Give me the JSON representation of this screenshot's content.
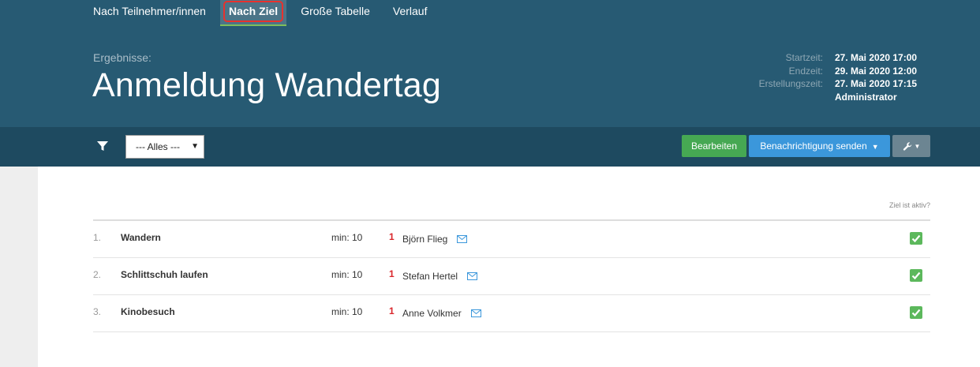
{
  "tabs": [
    {
      "label": "Nach Teilnehmer/innen",
      "active": false
    },
    {
      "label": "Nach Ziel",
      "active": true
    },
    {
      "label": "Große Tabelle",
      "active": false
    },
    {
      "label": "Verlauf",
      "active": false
    }
  ],
  "header": {
    "subtitle": "Ergebnisse:",
    "title": "Anmeldung Wandertag",
    "meta": [
      {
        "label": "Startzeit:",
        "value": "27. Mai 2020 17:00"
      },
      {
        "label": "Endzeit:",
        "value": "29. Mai 2020 12:00"
      },
      {
        "label": "Erstellungszeit:",
        "value": "27. Mai 2020 17:15",
        "value2": "Administrator"
      }
    ]
  },
  "toolbar": {
    "filter_icon": "filter-icon",
    "select_value": "--- Alles ---",
    "edit_label": "Bearbeiten",
    "notify_label": "Benachrichtigung senden",
    "tools_icon": "wrench-icon"
  },
  "list": {
    "active_header": "Ziel ist aktiv?",
    "items": [
      {
        "num": "1.",
        "name": "Wandern",
        "min": "min: 10",
        "count": "1",
        "person": "Björn Flieg",
        "active": true
      },
      {
        "num": "2.",
        "name": "Schlittschuh laufen",
        "min": "min: 10",
        "count": "1",
        "person": "Stefan Hertel",
        "active": true
      },
      {
        "num": "3.",
        "name": "Kinobesuch",
        "min": "min: 10",
        "count": "1",
        "person": "Anne Volkmer",
        "active": true
      }
    ]
  },
  "colors": {
    "header_bg": "#275a73",
    "toolbar_bg": "#1e4a60",
    "edit_button": "#46a853",
    "notify_button": "#3b97db",
    "count_red": "#d9262b",
    "check_green": "#5cb85c"
  }
}
